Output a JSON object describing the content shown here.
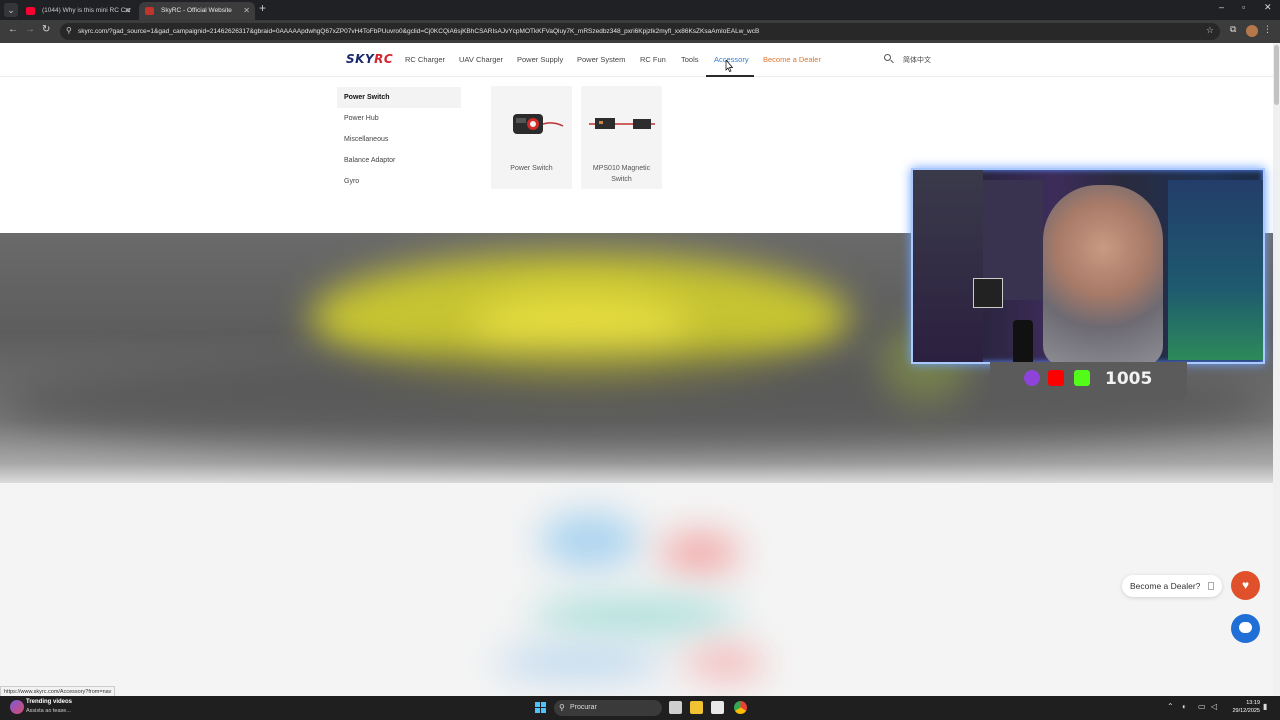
{
  "browser": {
    "tabs": [
      {
        "title": "(1044) Why is this mini RC Car",
        "active": false
      },
      {
        "title": "SkyRC - Official Website",
        "active": true
      }
    ],
    "url": "skyrc.com/?gad_source=1&gad_campaignid=21462626317&gbraid=0AAAAApdwhgQ67xZP07vH4ToFbPUuvro0&gclid=Cj0KCQiA6sjKBhCSARIsAJvYcpMOTkKFVaQluy7K_mRSzedbz348_pxri6Kpjzlk2myfl_xx86KsZKsaAmIoEALw_wcB",
    "status_url": "https://www.skyrc.com/Accessory?from=nav"
  },
  "site": {
    "logo_sky": "SKY",
    "logo_rc": "RC",
    "nav": [
      {
        "label": "RC Charger"
      },
      {
        "label": "UAV Charger"
      },
      {
        "label": "Power Supply"
      },
      {
        "label": "Power System"
      },
      {
        "label": "RC Fun"
      },
      {
        "label": "Tools"
      },
      {
        "label": "Accessory"
      },
      {
        "label": "Become a Dealer"
      }
    ],
    "language": "简体中文"
  },
  "mega_menu": {
    "categories": [
      {
        "label": "Power Switch",
        "selected": true
      },
      {
        "label": "Power Hub"
      },
      {
        "label": "Miscellaneous"
      },
      {
        "label": "Balance Adaptor"
      },
      {
        "label": "Gyro"
      }
    ],
    "products": [
      {
        "name": "Power Switch"
      },
      {
        "name": "MPS010 Magnetic Switch"
      }
    ]
  },
  "widgets": {
    "dealer_prompt": "Become a Dealer?"
  },
  "overlay": {
    "viewer_count": "1005"
  },
  "taskbar": {
    "widget_title": "Trending videos",
    "widget_subtitle": "Assista ao tease...",
    "search_placeholder": "Procurar",
    "time": "13:19",
    "date": "29/12/2025"
  },
  "colors": {
    "accent": "#2f7fd0",
    "dealer": "#e0762b",
    "brand_red": "#d3242d",
    "brand_navy": "#1a2a6c"
  }
}
